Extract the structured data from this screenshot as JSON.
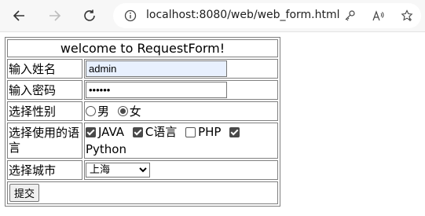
{
  "browser": {
    "url": "localhost:8080/web/web_form.html"
  },
  "form": {
    "title": "welcome to RequestForm!",
    "name_label": "输入姓名",
    "name_value": "admin",
    "password_label": "输入密码",
    "password_value": "••••••",
    "gender_label": "选择性别",
    "gender_options": [
      "男",
      "女"
    ],
    "gender_selected": "女",
    "languages_label": "选择使用的语言",
    "languages": [
      {
        "label": "JAVA",
        "checked": true
      },
      {
        "label": "C语言",
        "checked": true
      },
      {
        "label": "PHP",
        "checked": false
      },
      {
        "label": "Python",
        "checked": true
      }
    ],
    "city_label": "选择城市",
    "city_selected": "上海",
    "submit_label": "提交"
  }
}
